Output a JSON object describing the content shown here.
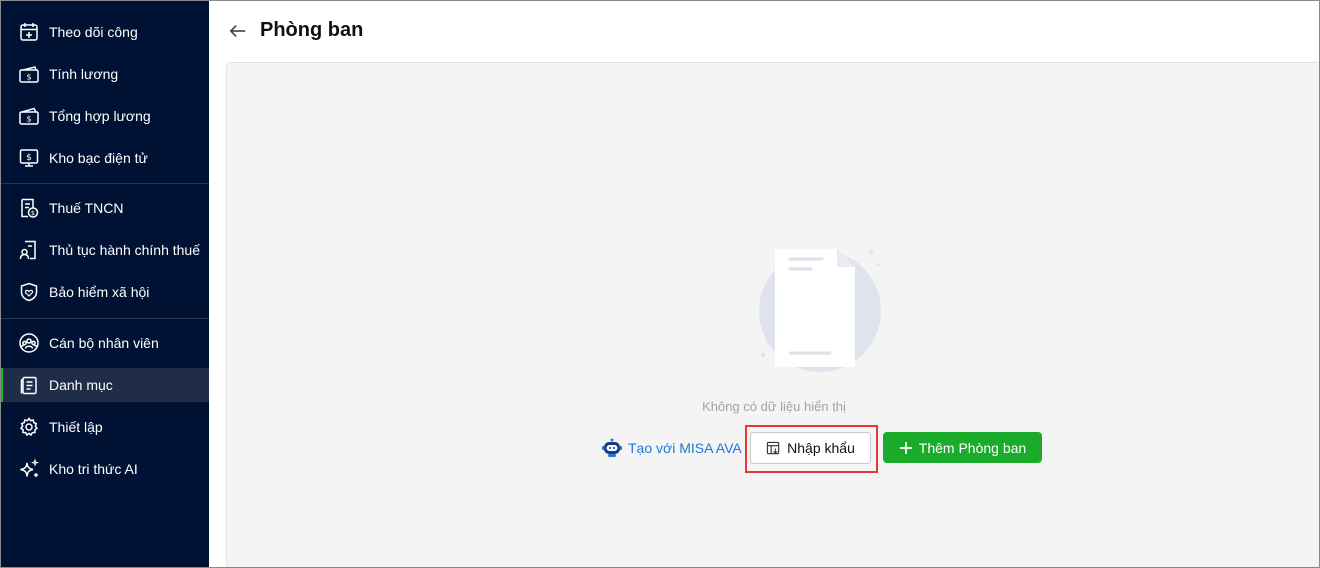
{
  "sidebar": {
    "items": [
      {
        "label": "Theo dõi công",
        "icon": "calendar-plus-icon"
      },
      {
        "label": "Tính lương",
        "icon": "money-bill-icon"
      },
      {
        "label": "Tổng hợp lương",
        "icon": "money-stack-icon"
      },
      {
        "label": "Kho bạc điện tử",
        "icon": "monitor-dollar-icon"
      },
      {
        "label": "Thuế TNCN",
        "icon": "tax-document-icon"
      },
      {
        "label": "Thủ tục hành chính thuế",
        "icon": "document-person-icon"
      },
      {
        "label": "Bảo hiểm xã hội",
        "icon": "shield-heart-icon"
      },
      {
        "label": "Cán bộ nhân viên",
        "icon": "people-group-icon"
      },
      {
        "label": "Danh mục",
        "icon": "list-document-icon",
        "active": true
      },
      {
        "label": "Thiết lập",
        "icon": "gear-icon"
      },
      {
        "label": "Kho tri thức AI",
        "icon": "sparkle-icon"
      }
    ]
  },
  "header": {
    "title": "Phòng ban",
    "back_icon": "arrow-left-icon"
  },
  "main": {
    "empty_text": "Không có dữ liệu hiển thị",
    "ava_link_label": "Tạo với MISA AVA",
    "import_label": "Nhập khẩu",
    "add_label": "Thêm Phòng ban"
  },
  "colors": {
    "sidebar_bg": "#001233",
    "active_indicator": "#1db12e",
    "primary_green": "#1aab2b",
    "link_blue": "#1f77d9",
    "highlight_red": "#e53935"
  }
}
